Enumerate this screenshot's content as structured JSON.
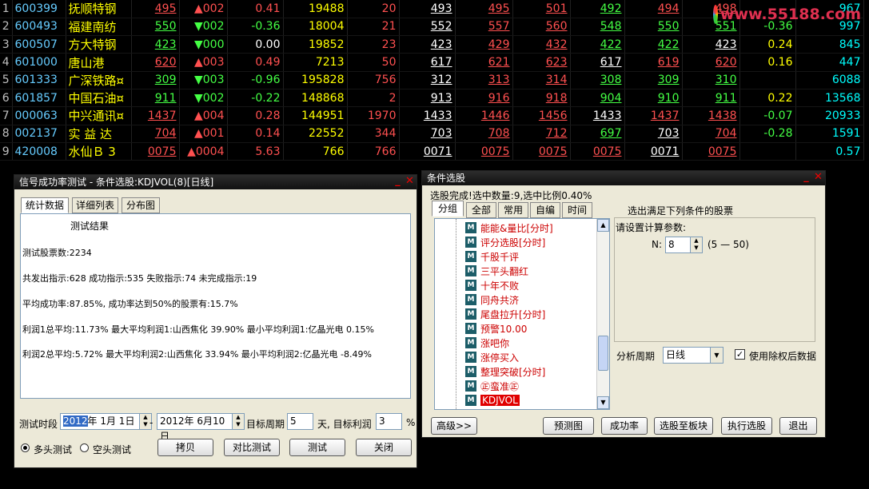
{
  "stocks": [
    {
      "idx": "1",
      "code": "600399",
      "name": "抚顺特钢",
      "a": "495",
      "chg": "▲002",
      "pct": "0.41",
      "vol": "19488",
      "cur": "20",
      "b": "493",
      "c": "495",
      "d": "501",
      "e": "492",
      "f": "494",
      "g": "498",
      "h": "",
      "i": "967"
    },
    {
      "idx": "2",
      "code": "600493",
      "name": "福建南纺",
      "a": "550",
      "chg": "▼002",
      "pct": "-0.36",
      "vol": "18004",
      "cur": "21",
      "b": "552",
      "c": "557",
      "d": "560",
      "e": "548",
      "f": "550",
      "g": "551",
      "h": "-0.36",
      "i": "997"
    },
    {
      "idx": "3",
      "code": "600507",
      "name": "方大特钢",
      "a": "423",
      "chg": "▼000",
      "pct": "0.00",
      "vol": "19852",
      "cur": "23",
      "b": "423",
      "c": "429",
      "d": "432",
      "e": "422",
      "f": "422",
      "g": "423",
      "h": "0.24",
      "i": "845"
    },
    {
      "idx": "4",
      "code": "601000",
      "name": "唐山港",
      "a": "620",
      "chg": "▲003",
      "pct": "0.49",
      "vol": "7213",
      "cur": "50",
      "b": "617",
      "c": "621",
      "d": "623",
      "e": "617",
      "f": "619",
      "g": "620",
      "h": "0.16",
      "i": "447"
    },
    {
      "idx": "5",
      "code": "601333",
      "name": "广深铁路¤",
      "a": "309",
      "chg": "▼003",
      "pct": "-0.96",
      "vol": "195828",
      "cur": "756",
      "b": "312",
      "c": "313",
      "d": "314",
      "e": "308",
      "f": "309",
      "g": "310",
      "h": "",
      "i": "6088"
    },
    {
      "idx": "6",
      "code": "601857",
      "name": "中国石油¤",
      "a": "911",
      "chg": "▼002",
      "pct": "-0.22",
      "vol": "148868",
      "cur": "2",
      "b": "913",
      "c": "916",
      "d": "918",
      "e": "904",
      "f": "910",
      "g": "911",
      "h": "0.22",
      "i": "13568"
    },
    {
      "idx": "7",
      "code": "000063",
      "name": "中兴通讯¤",
      "a": "1437",
      "chg": "▲004",
      "pct": "0.28",
      "vol": "144951",
      "cur": "1970",
      "b": "1433",
      "c": "1446",
      "d": "1456",
      "e": "1433",
      "f": "1437",
      "g": "1438",
      "h": "-0.07",
      "i": "20933"
    },
    {
      "idx": "8",
      "code": "002137",
      "name": "实 益 达",
      "a": "704",
      "chg": "▲001",
      "pct": "0.14",
      "vol": "22552",
      "cur": "344",
      "b": "703",
      "c": "708",
      "d": "712",
      "e": "697",
      "f": "703",
      "g": "704",
      "h": "-0.28",
      "i": "1591"
    },
    {
      "idx": "9",
      "code": "420008",
      "name": "水仙Ｂ 3",
      "a": "0075",
      "chg": "▲0004",
      "pct": "5.63",
      "vol": "766",
      "cur": "766",
      "b": "0071",
      "c": "0075",
      "d": "0075",
      "e": "0075",
      "f": "0071",
      "g": "0075",
      "h": "",
      "i": "0.57"
    }
  ],
  "watermark": "www.55188.com",
  "test_dialog": {
    "title": "信号成功率测试 - 条件选股:KDJVOL(8)[日线]",
    "tabs": [
      "统计数据",
      "详细列表",
      "分布图"
    ],
    "result_title": "测试结果",
    "lines": [
      "测试股票数:2234",
      "共发出指示:628 成功指示:535 失败指示:74 未完成指示:19",
      "平均成功率:87.85%, 成功率达到50%的股票有:15.7%",
      "利润1总平均:11.73% 最大平均利润1:山西焦化 39.90% 最小平均利润1:亿晶光电 0.15%",
      "利润2总平均:5.72% 最大平均利润2:山西焦化 33.94% 最小平均利润2:亿晶光电 -8.49%"
    ],
    "period_label": "测试时段",
    "start_year": "2012",
    "start_rest": "年  1月  1日",
    "dash": "-",
    "end_date": "2012年  6月10日",
    "target_period_label": "目标周期",
    "target_period_value": "5",
    "target_profit_label": "天, 目标利润",
    "target_profit_value": "3",
    "pct_sign": "%",
    "long_label": "多头测试",
    "short_label": "空头测试",
    "buttons": [
      "拷贝",
      "对比测试",
      "测试",
      "关闭"
    ]
  },
  "select_dialog": {
    "title": "条件选股",
    "status": "选股完成!选中数量:9,选中比例0.40%",
    "tabs": [
      "分组",
      "全部",
      "常用",
      "自编",
      "时间"
    ],
    "tree": [
      "能能&量比[分时]",
      "评分选股[分时]",
      "千股千评",
      "三平头翻红",
      "十年不败",
      "同舟共济",
      "尾盘拉升[分时]",
      "预警10.00",
      "涨吧你",
      "涨停买入",
      "整理突破[分时]",
      "㊣蛮准㊣",
      "KDJVOL"
    ],
    "heading": "选出满足下列条件的股票",
    "param_label": "请设置计算参数:",
    "n_label": "N:",
    "n_value": "8",
    "n_range": "(5 — 50)",
    "period_label": "分析周期",
    "period_value": "日线",
    "adjust_label": "使用除权后数据",
    "buttons": [
      "高级>>",
      "预测图",
      "成功率",
      "选股至板块",
      "执行选股",
      "退出"
    ]
  },
  "colors": {
    "up": "#ff5050",
    "down": "#44ff44",
    "selected": "#e00000"
  }
}
